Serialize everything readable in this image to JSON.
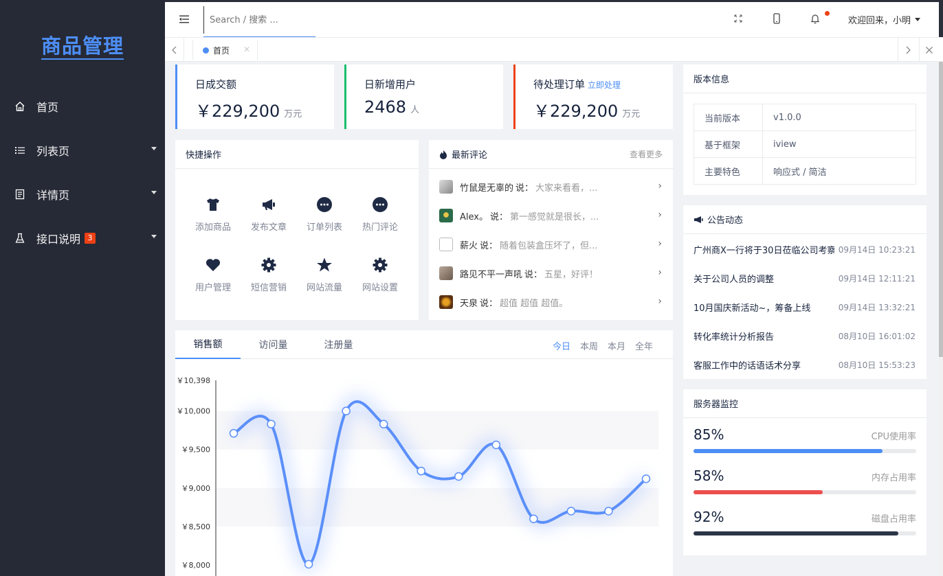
{
  "sidebar": {
    "logo": "商品管理",
    "items": [
      {
        "label": "首页",
        "icon": "home-icon",
        "badge": ""
      },
      {
        "label": "列表页",
        "icon": "list-icon",
        "badge": ""
      },
      {
        "label": "详情页",
        "icon": "document-icon",
        "badge": ""
      },
      {
        "label": "接口说明",
        "icon": "flask-icon",
        "badge": "3"
      }
    ]
  },
  "topbar": {
    "search_placeholder": "Search / 搜索 ...",
    "welcome": "欢迎回来，小明"
  },
  "tabs": [
    {
      "label": "首页"
    }
  ],
  "stats": [
    {
      "title": "日成交额",
      "value": "￥229,200",
      "unit": "万元",
      "accent": "#4d8ef5",
      "link": ""
    },
    {
      "title": "日新增用户",
      "value": "2468",
      "unit": "人",
      "accent": "#19be6b",
      "link": ""
    },
    {
      "title": "待处理订单",
      "value": "￥229,200",
      "unit": "万元",
      "accent": "#ed4014",
      "link": "立即处理"
    }
  ],
  "quick_actions": {
    "title": "快捷操作",
    "items": [
      {
        "label": "添加商品",
        "icon": "tshirt-icon"
      },
      {
        "label": "发布文章",
        "icon": "megaphone-icon"
      },
      {
        "label": "订单列表",
        "icon": "chat-bubble-icon"
      },
      {
        "label": "热门评论",
        "icon": "chat-bubble-icon"
      },
      {
        "label": "用户管理",
        "icon": "heart-icon"
      },
      {
        "label": "短信营销",
        "icon": "gear-icon"
      },
      {
        "label": "网站流量",
        "icon": "star-icon"
      },
      {
        "label": "网站设置",
        "icon": "gear-icon"
      }
    ]
  },
  "comments": {
    "title": "最新评论",
    "more": "查看更多",
    "items": [
      {
        "user": "竹鼠是无辜的",
        "said": "说：",
        "text": "大家来看看，..."
      },
      {
        "user": "Alex。",
        "said": "说：",
        "text": "第一感觉就是很长，..."
      },
      {
        "user": "薪火",
        "said": "说：",
        "text": "随着包装盒压坏了，但..."
      },
      {
        "user": "路见不平一声吼",
        "said": "说：",
        "text": "五星，好评！"
      },
      {
        "user": "天泉",
        "said": "说：",
        "text": "超值 超值 超值。"
      }
    ]
  },
  "chart_tabs": [
    "销售额",
    "访问量",
    "注册量"
  ],
  "chart_ranges": [
    "今日",
    "本周",
    "本月",
    "全年"
  ],
  "chart_data": {
    "type": "line",
    "x": [
      1,
      2,
      3,
      4,
      5,
      6,
      7,
      8,
      9,
      10,
      11,
      12
    ],
    "values": [
      9710,
      9830,
      8010,
      10000,
      9830,
      9220,
      9150,
      9560,
      8600,
      8700,
      8700,
      9120
    ],
    "ylim": [
      8000,
      10398
    ],
    "yticks": [
      "￥10,398",
      "￥10,000",
      "￥9,500",
      "￥9,000",
      "￥8,500",
      "￥8,000"
    ],
    "color": "#5b8ff9"
  },
  "version": {
    "title": "版本信息",
    "rows": [
      {
        "k": "当前版本",
        "v": "v1.0.0"
      },
      {
        "k": "基于框架",
        "v": "iview"
      },
      {
        "k": "主要特色",
        "v": "响应式 / 简洁"
      }
    ]
  },
  "notices": {
    "title": "公告动态",
    "items": [
      {
        "title": "广州商X一行将于30日莅临公司考察调研",
        "time": "09月14日 10:23:21"
      },
      {
        "title": "关于公司人员的调整",
        "time": "09月14日 12:11:21"
      },
      {
        "title": "10月国庆新活动~，筹备上线",
        "time": "09月14日 13:32:21"
      },
      {
        "title": "转化率统计分析报告",
        "time": "08月10日 16:01:02"
      },
      {
        "title": "客服工作中的话语话术分享",
        "time": "08月10日 15:53:23"
      }
    ]
  },
  "monitor": {
    "title": "服务器监控",
    "items": [
      {
        "pct": "85%",
        "value": 0.85,
        "label": "CPU使用率",
        "color": "#4d8ef5"
      },
      {
        "pct": "58%",
        "value": 0.58,
        "label": "内存占用率",
        "color": "#ed4f4f"
      },
      {
        "pct": "92%",
        "value": 0.92,
        "label": "磁盘占用率",
        "color": "#2b3548"
      }
    ]
  }
}
